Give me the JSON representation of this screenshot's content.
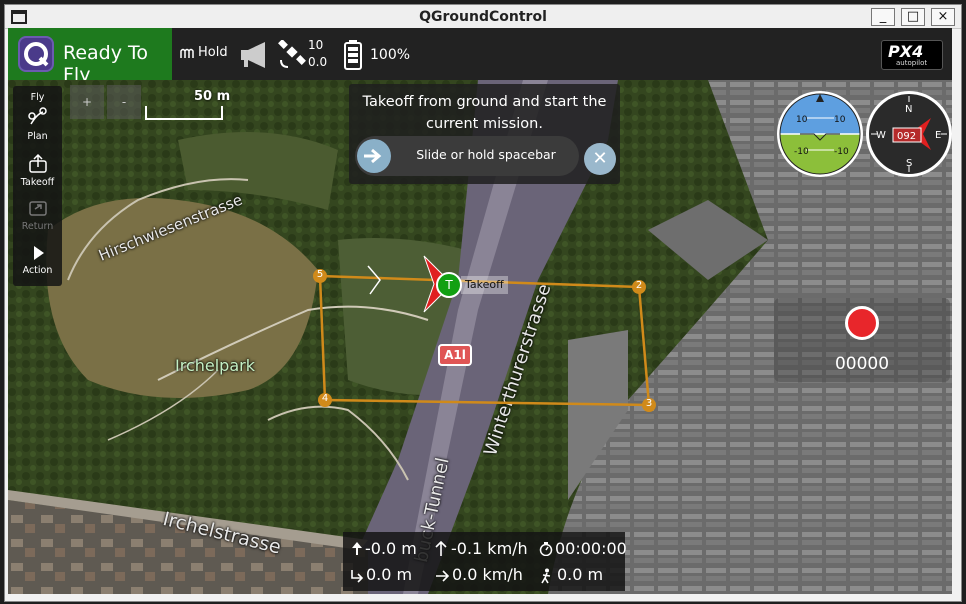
{
  "window": {
    "title": "QGroundControl",
    "min_glyph": "_",
    "max_glyph": "□",
    "close_glyph": "×"
  },
  "toolbar": {
    "status": "Ready To Fly",
    "flight_mode": "Hold",
    "gps_count": "10",
    "gps_hdop": "0.0",
    "battery": "100%",
    "logo_text": "PX4",
    "logo_sub": "autopilot",
    "status_color": "#1e7a1e"
  },
  "fly_tools": [
    {
      "label": "Fly",
      "icon": "fly-icon"
    },
    {
      "label": "Plan",
      "icon": "plan-icon"
    },
    {
      "label": "Takeoff",
      "icon": "takeoff-icon"
    },
    {
      "label": "Return",
      "icon": "return-icon"
    },
    {
      "label": "Action",
      "icon": "action-icon"
    }
  ],
  "map": {
    "zoom_in": "+",
    "zoom_out": "-",
    "scale": "50 m",
    "labels": {
      "hirschwiesen": "Hirschwiesenstrasse",
      "irchelpark": "Irchelpark",
      "winterthurer": "Winterthurerstrasse",
      "buck_tunnel": "buck-Tunnel",
      "irchelstrasse": "Irchelstrasse",
      "road_sign": "A1l"
    },
    "takeoff_marker": "T",
    "takeoff_label": "Takeoff",
    "waypoints": [
      "2",
      "3",
      "4",
      "5"
    ]
  },
  "guided": {
    "message": "Takeoff from ground and start the current mission.",
    "slider_text": "Slide or hold spacebar",
    "cancel_glyph": "✕"
  },
  "instruments": {
    "attitude_pitch_up": "10",
    "attitude_pitch_down": "-10",
    "heading": "092",
    "compass_n": "N",
    "compass_e": "E",
    "compass_s": "S",
    "compass_w": "W"
  },
  "recorder": {
    "count": "00000",
    "record_color": "#e8262b"
  },
  "telemetry": {
    "altitude_rel": "-0.0 m",
    "vertical_speed": "-0.1 km/h",
    "flight_time": "00:00:00",
    "distance_home": "0.0 m",
    "horizontal_speed": "0.0 km/h",
    "distance_gcs": "0.0 m"
  }
}
